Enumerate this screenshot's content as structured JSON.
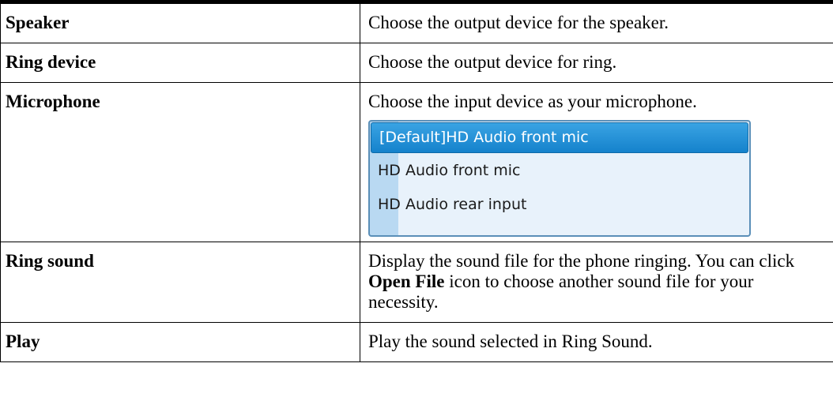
{
  "rows": [
    {
      "term": "Speaker",
      "desc": "Choose the output device for the speaker."
    },
    {
      "term": "Ring device",
      "desc": "Choose the output device for ring."
    },
    {
      "term": "Microphone",
      "desc": "Choose the input device as your microphone.",
      "dropdown": {
        "options": [
          "[Default]HD Audio front mic",
          "HD Audio front mic",
          "HD Audio rear input"
        ],
        "selected": "[Default]HD Audio front mic"
      }
    },
    {
      "term": "Ring sound",
      "desc_before": "Display the sound file for the phone ringing. You can click ",
      "desc_bold": "Open File",
      "desc_after": " icon to choose another sound file for your necessity."
    },
    {
      "term": "Play",
      "desc": "Play the sound selected in Ring Sound."
    }
  ]
}
